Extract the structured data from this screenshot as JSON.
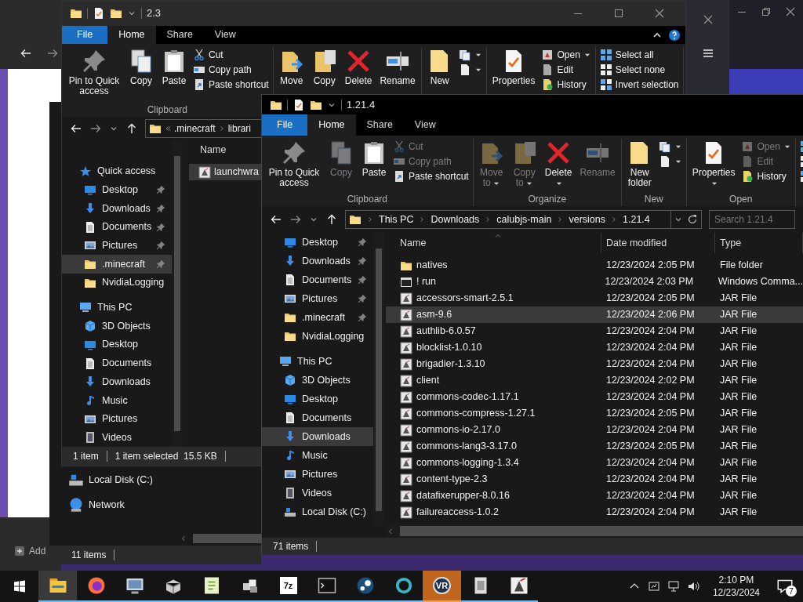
{
  "browser": {
    "add_label": "Add"
  },
  "back_explorer": {
    "nav": [
      {
        "label": "Local Disk (C:)",
        "kind": "drive"
      },
      {
        "label": "Network",
        "kind": "network"
      }
    ],
    "status": "11 items"
  },
  "explorer_2_3": {
    "title": "2.3",
    "tabs": [
      {
        "label": "File",
        "kind": "menu",
        "selected": false
      },
      {
        "label": "Home",
        "kind": "tab",
        "selected": true
      },
      {
        "label": "Share",
        "kind": "tab",
        "selected": false
      },
      {
        "label": "View",
        "kind": "tab",
        "selected": false
      }
    ],
    "ribbon": [
      {
        "label": "Clipboard",
        "large": [
          {
            "label": "Pin to Quick access",
            "kind": "pin",
            "disabled": false
          },
          {
            "label": "Copy",
            "kind": "copy",
            "disabled": false
          },
          {
            "label": "Paste",
            "kind": "paste",
            "disabled": false
          }
        ],
        "small": [
          {
            "label": "Cut",
            "kind": "cut",
            "disabled": false
          },
          {
            "label": "Copy path",
            "kind": "copy-path",
            "disabled": false
          },
          {
            "label": "Paste shortcut",
            "kind": "paste-shortcut",
            "disabled": false
          }
        ]
      },
      {
        "large": [
          {
            "label": "Move",
            "kind": "move-to",
            "disabled": false
          },
          {
            "label": "Copy",
            "kind": "copy-to",
            "disabled": false
          },
          {
            "label": "Delete",
            "kind": "delete",
            "disabled": false
          },
          {
            "label": "Rename",
            "kind": "rename",
            "disabled": false
          }
        ]
      },
      {
        "large": [
          {
            "label": "New",
            "kind": "new-folder",
            "disabled": false
          }
        ],
        "small": [
          {
            "kind": "new-item",
            "dropdown": true,
            "disabled": false
          },
          {
            "kind": "easy-access",
            "dropdown": true,
            "disabled": false
          }
        ]
      },
      {
        "large": [
          {
            "label": "Properties",
            "kind": "properties",
            "disabled": false
          }
        ],
        "small": [
          {
            "label": "Open",
            "kind": "open",
            "dropdown": true,
            "disabled": false
          },
          {
            "label": "Edit",
            "kind": "edit",
            "disabled": false
          },
          {
            "label": "History",
            "kind": "history",
            "disabled": false
          }
        ]
      },
      {
        "small": [
          {
            "label": "Select all",
            "kind": "select-all",
            "disabled": false
          },
          {
            "label": "Select none",
            "kind": "select-none",
            "disabled": false
          },
          {
            "label": "Invert selection",
            "kind": "invert-selection",
            "disabled": false
          }
        ]
      }
    ],
    "address": [
      ".minecraft",
      "librari"
    ],
    "columns": [
      {
        "label": "Name",
        "sorted": false
      }
    ],
    "files": [
      {
        "name": "launchwra",
        "kind": "jar",
        "selected": true
      }
    ],
    "nav": [
      {
        "label": "Quick access",
        "kind": "star",
        "selected": false,
        "pinned": false,
        "children": [
          {
            "label": "Desktop",
            "kind": "desktop",
            "selected": false,
            "pinned": true
          },
          {
            "label": "Downloads",
            "kind": "downloads",
            "selected": false,
            "pinned": true
          },
          {
            "label": "Documents",
            "kind": "documents",
            "selected": false,
            "pinned": true
          },
          {
            "label": "Pictures",
            "kind": "pictures",
            "selected": false,
            "pinned": true
          },
          {
            "label": ".minecraft",
            "kind": "folder",
            "selected": true,
            "pinned": true
          },
          {
            "label": "NvidiaLogging",
            "kind": "folder",
            "selected": false,
            "pinned": false
          }
        ]
      },
      {
        "label": "This PC",
        "kind": "thispc",
        "selected": false,
        "pinned": false,
        "children": [
          {
            "label": "3D Objects",
            "kind": "objects3d",
            "selected": false,
            "pinned": false
          },
          {
            "label": "Desktop",
            "kind": "desktop",
            "selected": false,
            "pinned": false
          },
          {
            "label": "Documents",
            "kind": "documents",
            "selected": false,
            "pinned": false
          },
          {
            "label": "Downloads",
            "kind": "downloads",
            "selected": false,
            "pinned": false
          },
          {
            "label": "Music",
            "kind": "music",
            "selected": false,
            "pinned": false
          },
          {
            "label": "Pictures",
            "kind": "pictures",
            "selected": false,
            "pinned": false
          },
          {
            "label": "Videos",
            "kind": "videos",
            "selected": false,
            "pinned": false
          }
        ]
      }
    ],
    "status": [
      "1 item",
      "1 item selected  15.5 KB"
    ]
  },
  "explorer_1_21_4": {
    "title": "1.21.4",
    "tabs": [
      {
        "label": "File",
        "kind": "menu",
        "selected": false
      },
      {
        "label": "Home",
        "kind": "tab",
        "selected": true
      },
      {
        "label": "Share",
        "kind": "tab",
        "selected": false
      },
      {
        "label": "View",
        "kind": "tab",
        "selected": false
      }
    ],
    "ribbon": [
      {
        "label": "Clipboard",
        "large": [
          {
            "label": "Pin to Quick access",
            "kind": "pin",
            "disabled": false
          },
          {
            "label": "Copy",
            "kind": "copy",
            "disabled": true
          },
          {
            "label": "Paste",
            "kind": "paste",
            "disabled": false
          }
        ],
        "small": [
          {
            "label": "Cut",
            "kind": "cut",
            "disabled": true
          },
          {
            "label": "Copy path",
            "kind": "copy-path",
            "disabled": true
          },
          {
            "label": "Paste shortcut",
            "kind": "paste-shortcut",
            "disabled": false
          }
        ]
      },
      {
        "label": "Organize",
        "large": [
          {
            "label": "Move to",
            "kind": "move-to",
            "dropdown": true,
            "disabled": true
          },
          {
            "label": "Copy to",
            "kind": "copy-to",
            "dropdown": true,
            "disabled": true
          },
          {
            "label": "Delete",
            "kind": "delete",
            "dropdown": true,
            "disabled": false
          },
          {
            "label": "Rename",
            "kind": "rename",
            "disabled": true
          }
        ]
      },
      {
        "label": "New",
        "large": [
          {
            "label": "New folder",
            "kind": "new-folder",
            "disabled": false
          }
        ],
        "small": [
          {
            "kind": "new-item",
            "dropdown": true,
            "disabled": false
          },
          {
            "kind": "easy-access",
            "dropdown": true,
            "disabled": false
          }
        ]
      },
      {
        "label": "Open",
        "large": [
          {
            "label": "Properties",
            "kind": "properties",
            "dropdown": true,
            "disabled": false
          }
        ],
        "small": [
          {
            "label": "Open",
            "kind": "open",
            "dropdown": true,
            "disabled": true
          },
          {
            "label": "Edit",
            "kind": "edit",
            "disabled": true
          },
          {
            "label": "History",
            "kind": "history",
            "disabled": false
          }
        ]
      },
      {
        "small": [
          {
            "kind": "select-all",
            "disabled": false
          },
          {
            "kind": "select-none",
            "disabled": false
          },
          {
            "kind": "invert-selection",
            "disabled": false
          }
        ]
      }
    ],
    "address": [
      "This PC",
      "Downloads",
      "calubjs-main",
      "versions",
      "1.21.4"
    ],
    "search": {
      "placeholder": "Search 1.21.4"
    },
    "columns": [
      {
        "label": "Name",
        "sorted": true
      },
      {
        "label": "Date modified",
        "sorted": false
      },
      {
        "label": "Type",
        "sorted": false
      }
    ],
    "nav": [
      {
        "label": "Desktop",
        "kind": "desktop",
        "selected": false,
        "pinned": true
      },
      {
        "label": "Downloads",
        "kind": "downloads",
        "selected": false,
        "pinned": true
      },
      {
        "label": "Documents",
        "kind": "documents",
        "selected": false,
        "pinned": true
      },
      {
        "label": "Pictures",
        "kind": "pictures",
        "selected": false,
        "pinned": true
      },
      {
        "label": ".minecraft",
        "kind": "folder",
        "selected": false,
        "pinned": true
      },
      {
        "label": "NvidiaLogging",
        "kind": "folder",
        "selected": false,
        "pinned": false
      },
      {
        "label": "This PC",
        "kind": "thispc",
        "selected": false,
        "pinned": false,
        "children": [
          {
            "label": "3D Objects",
            "kind": "objects3d",
            "selected": false,
            "pinned": false
          },
          {
            "label": "Desktop",
            "kind": "desktop",
            "selected": false,
            "pinned": false
          },
          {
            "label": "Documents",
            "kind": "documents",
            "selected": false,
            "pinned": false
          },
          {
            "label": "Downloads",
            "kind": "downloads",
            "selected": true,
            "pinned": false
          },
          {
            "label": "Music",
            "kind": "music",
            "selected": false,
            "pinned": false
          },
          {
            "label": "Pictures",
            "kind": "pictures",
            "selected": false,
            "pinned": false
          },
          {
            "label": "Videos",
            "kind": "videos",
            "selected": false,
            "pinned": false
          },
          {
            "label": "Local Disk (C:)",
            "kind": "drive",
            "selected": false,
            "pinned": false
          }
        ]
      }
    ],
    "files": [
      {
        "name": "natives",
        "date": "12/23/2024 2:05 PM",
        "type": "File folder",
        "kind": "folder",
        "selected": false
      },
      {
        "name": "! run",
        "date": "12/23/2024 2:03 PM",
        "type": "Windows Comma...",
        "kind": "cmd",
        "selected": false
      },
      {
        "name": "accessors-smart-2.5.1",
        "date": "12/23/2024 2:05 PM",
        "type": "JAR File",
        "kind": "jar",
        "selected": false
      },
      {
        "name": "asm-9.6",
        "date": "12/23/2024 2:06 PM",
        "type": "JAR File",
        "kind": "jar",
        "selected": true
      },
      {
        "name": "authlib-6.0.57",
        "date": "12/23/2024 2:04 PM",
        "type": "JAR File",
        "kind": "jar",
        "selected": false
      },
      {
        "name": "blocklist-1.0.10",
        "date": "12/23/2024 2:04 PM",
        "type": "JAR File",
        "kind": "jar",
        "selected": false
      },
      {
        "name": "brigadier-1.3.10",
        "date": "12/23/2024 2:04 PM",
        "type": "JAR File",
        "kind": "jar",
        "selected": false
      },
      {
        "name": "client",
        "date": "12/23/2024 2:02 PM",
        "type": "JAR File",
        "kind": "jar",
        "selected": false
      },
      {
        "name": "commons-codec-1.17.1",
        "date": "12/23/2024 2:04 PM",
        "type": "JAR File",
        "kind": "jar",
        "selected": false
      },
      {
        "name": "commons-compress-1.27.1",
        "date": "12/23/2024 2:05 PM",
        "type": "JAR File",
        "kind": "jar",
        "selected": false
      },
      {
        "name": "commons-io-2.17.0",
        "date": "12/23/2024 2:04 PM",
        "type": "JAR File",
        "kind": "jar",
        "selected": false
      },
      {
        "name": "commons-lang3-3.17.0",
        "date": "12/23/2024 2:05 PM",
        "type": "JAR File",
        "kind": "jar",
        "selected": false
      },
      {
        "name": "commons-logging-1.3.4",
        "date": "12/23/2024 2:04 PM",
        "type": "JAR File",
        "kind": "jar",
        "selected": false
      },
      {
        "name": "content-type-2.3",
        "date": "12/23/2024 2:04 PM",
        "type": "JAR File",
        "kind": "jar",
        "selected": false
      },
      {
        "name": "datafixerupper-8.0.16",
        "date": "12/23/2024 2:04 PM",
        "type": "JAR File",
        "kind": "jar",
        "selected": false
      },
      {
        "name": "failureaccess-1.0.2",
        "date": "12/23/2024 2:04 PM",
        "type": "JAR File",
        "kind": "jar",
        "selected": false
      }
    ],
    "status": "71 items"
  },
  "taskbar": {
    "apps": [
      {
        "kind": "start",
        "selected": false,
        "running": false,
        "flashing": false
      },
      {
        "kind": "explorer",
        "selected": true,
        "running": true,
        "flashing": false
      },
      {
        "kind": "firefox",
        "selected": false,
        "running": true,
        "flashing": false
      },
      {
        "kind": "remote",
        "selected": false,
        "running": true,
        "flashing": false
      },
      {
        "kind": "box",
        "selected": false,
        "running": true,
        "flashing": false
      },
      {
        "kind": "notepad",
        "selected": false,
        "running": true,
        "flashing": false
      },
      {
        "kind": "blocks",
        "selected": false,
        "running": true,
        "flashing": false
      },
      {
        "kind": "archiver",
        "label": "7z",
        "selected": false,
        "running": true,
        "flashing": false
      },
      {
        "kind": "console",
        "selected": false,
        "running": true,
        "flashing": false
      },
      {
        "kind": "steam",
        "selected": false,
        "running": true,
        "flashing": false
      },
      {
        "kind": "ring",
        "selected": false,
        "running": true,
        "flashing": false
      },
      {
        "kind": "vr",
        "label": "VR",
        "selected": false,
        "running": true,
        "flashing": true
      },
      {
        "kind": "files",
        "selected": false,
        "running": true,
        "flashing": false
      },
      {
        "kind": "java",
        "selected": false,
        "running": true,
        "flashing": false
      }
    ],
    "time": "2:10 PM",
    "date": "12/23/2024",
    "notifications": "7"
  }
}
